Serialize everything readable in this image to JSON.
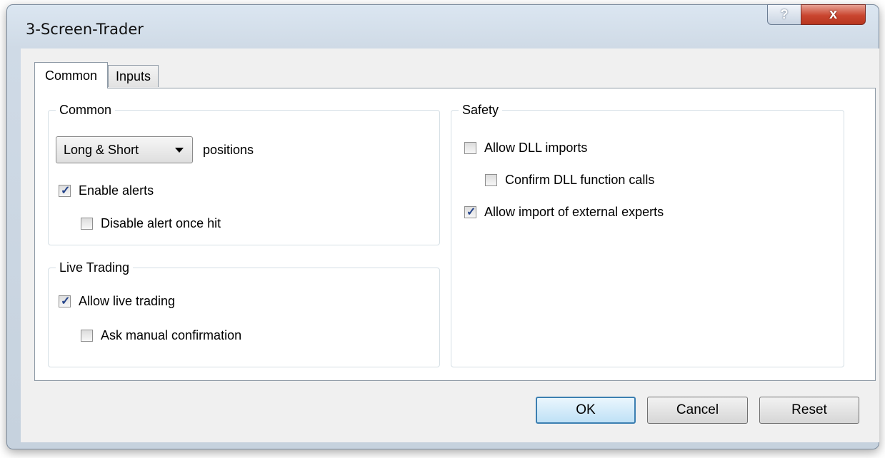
{
  "window": {
    "title": "3-Screen-Trader",
    "help_label": "?",
    "close_label": "x"
  },
  "tabs": [
    {
      "label": "Common",
      "active": true
    },
    {
      "label": "Inputs",
      "active": false
    }
  ],
  "common_group": {
    "title": "Common",
    "positions_select": {
      "selected": "Long & Short"
    },
    "positions_label": "positions",
    "enable_alerts": {
      "label": "Enable alerts",
      "checked": true
    },
    "disable_alert_once_hit": {
      "label": "Disable alert once hit",
      "checked": false
    }
  },
  "live_trading_group": {
    "title": "Live Trading",
    "allow_live_trading": {
      "label": "Allow live trading",
      "checked": true
    },
    "ask_manual_confirmation": {
      "label": "Ask manual confirmation",
      "checked": false
    }
  },
  "safety_group": {
    "title": "Safety",
    "allow_dll_imports": {
      "label": "Allow DLL imports",
      "checked": false
    },
    "confirm_dll_calls": {
      "label": "Confirm DLL function calls",
      "checked": false
    },
    "allow_external_experts": {
      "label": "Allow import of external experts",
      "checked": true
    }
  },
  "buttons": {
    "ok": "OK",
    "cancel": "Cancel",
    "reset": "Reset"
  },
  "colors": {
    "check_mark": "#24438a",
    "close_button": "#c9452f",
    "default_button_border": "#3c7fb1"
  }
}
